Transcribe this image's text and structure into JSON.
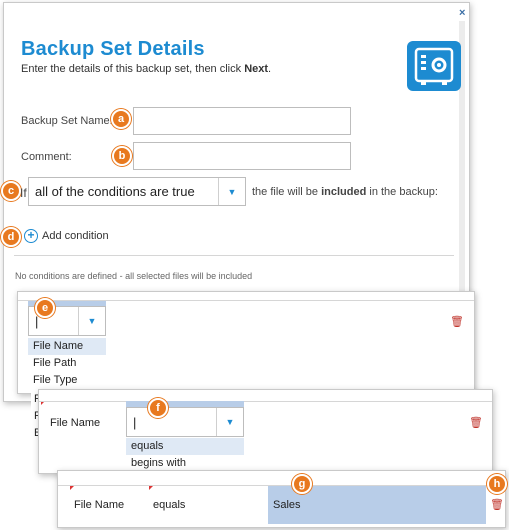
{
  "dialog": {
    "close_glyph": "×",
    "title": "Backup Set Details",
    "subtitle_pre": "Enter the details of this backup set, then click ",
    "subtitle_bold": "Next",
    "subtitle_post": ".",
    "name_label": "Backup Set Name:",
    "name_value": "",
    "comment_label": "Comment:",
    "comment_value": "",
    "if_label": "If",
    "match_select": "all of the conditions are true",
    "match_suffix_pre": "the file will be ",
    "match_suffix_bold": "included",
    "match_suffix_post": " in the backup:",
    "add_condition": "Add condition",
    "no_conditions": "No conditions are defined - all selected files will be included"
  },
  "callouts": [
    "a",
    "b",
    "c",
    "d",
    "e",
    "f",
    "g",
    "h"
  ],
  "panel_e": {
    "input_value": "|",
    "options": [
      "File Name",
      "File Path",
      "File Type",
      "Fi",
      "Fi",
      "E"
    ],
    "selected_index": 0
  },
  "panel_f": {
    "field_label": "File Name",
    "input_value": "|",
    "options": [
      "equals",
      "begins with"
    ],
    "selected_index": 0
  },
  "panel_g": {
    "field_label": "File Name",
    "operator": "equals",
    "value": "Sales"
  },
  "icons": {
    "plus": "plus-circle-icon",
    "trash": "trash-icon",
    "chevron": "chevron-down-icon",
    "safe": "safe-icon"
  },
  "colors": {
    "accent": "#1d8bd1",
    "callout": "#e8791f",
    "trash": "#c0332b",
    "highlight": "#b8cde8"
  }
}
